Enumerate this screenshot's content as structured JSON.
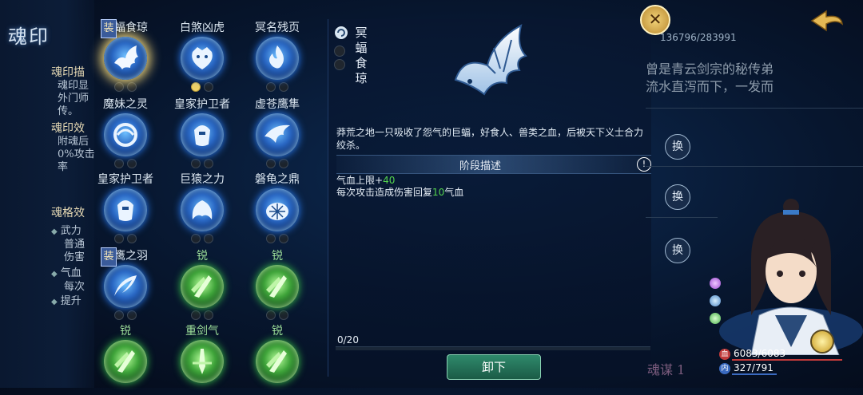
{
  "sidebar": {
    "title": "魂印",
    "section1_title": "魂印描",
    "section1_lines": [
      "魂印显",
      "外门师",
      "传。"
    ],
    "section2_title": "魂印效",
    "section2_lines": [
      "附魂后",
      "0%攻击",
      "率"
    ],
    "section3_title": "魂格效",
    "section3_items": [
      "武力",
      "普通",
      "伤害",
      "气血",
      "每次",
      "提升"
    ]
  },
  "grid": [
    {
      "label": "冥蝠食琼",
      "type": "blue",
      "icon": "bat-icon",
      "selected": true,
      "badge": "装",
      "slots": [
        "empty",
        "empty"
      ]
    },
    {
      "label": "白煞凶虎",
      "type": "blue",
      "icon": "tiger-icon",
      "selected": false,
      "badge": "",
      "slots": [
        "gold",
        "empty"
      ]
    },
    {
      "label": "冥名残页",
      "type": "blue",
      "icon": "flame-icon",
      "selected": false,
      "badge": "",
      "slots": [
        "empty",
        "empty"
      ]
    },
    {
      "label": "魔妹之灵",
      "type": "blue",
      "icon": "spirit-icon",
      "selected": false,
      "badge": "",
      "slots": [
        "empty",
        "empty"
      ]
    },
    {
      "label": "皇家护卫者",
      "type": "blue",
      "icon": "guardian-icon",
      "selected": false,
      "badge": "",
      "slots": [
        "empty",
        "empty"
      ]
    },
    {
      "label": "虚苍鹰隼",
      "type": "blue",
      "icon": "falcon-icon",
      "selected": false,
      "badge": "",
      "slots": [
        "empty",
        "empty"
      ]
    },
    {
      "label": "皇家护卫者",
      "type": "blue",
      "icon": "guardian-icon",
      "selected": false,
      "badge": "",
      "slots": [
        "empty",
        "empty"
      ]
    },
    {
      "label": "巨猿之力",
      "type": "blue",
      "icon": "ape-icon",
      "selected": false,
      "badge": "",
      "slots": [
        "empty",
        "empty"
      ]
    },
    {
      "label": "磐龟之鼎",
      "type": "blue",
      "icon": "turtle-icon",
      "selected": false,
      "badge": "",
      "slots": [
        "empty",
        "empty"
      ]
    },
    {
      "label": "狐鹰之羽",
      "type": "blue",
      "icon": "feather-icon",
      "selected": false,
      "badge": "装",
      "slots": [
        "empty",
        "empty"
      ]
    },
    {
      "label": "锐",
      "type": "green",
      "icon": "sharp-icon",
      "selected": false,
      "badge": "",
      "slots": [
        "empty",
        "empty"
      ]
    },
    {
      "label": "锐",
      "type": "green",
      "icon": "sharp-icon",
      "selected": false,
      "badge": "",
      "slots": [
        "empty",
        "empty"
      ]
    },
    {
      "label": "锐",
      "type": "green",
      "icon": "sharp-icon",
      "selected": false,
      "badge": "",
      "slots": []
    },
    {
      "label": "重剑气",
      "type": "green",
      "icon": "sword-qi-icon",
      "selected": false,
      "badge": "",
      "slots": []
    },
    {
      "label": "锐",
      "type": "green",
      "icon": "sharp-icon",
      "selected": false,
      "badge": "",
      "slots": []
    }
  ],
  "detail": {
    "name_chars": [
      "冥",
      "蝠",
      "食",
      "琼"
    ],
    "description": "莽荒之地一只吸收了怨气的巨蝠，好食人、兽类之血，后被天下义士合力绞杀。",
    "stage_label": "阶段描述",
    "info_symbol": "!",
    "stat1_prefix": "气血上限+",
    "stat1_value": "40",
    "stat2_prefix": "每次攻击造成伤害回复",
    "stat2_value": "10",
    "stat2_suffix": "气血",
    "progress_text": "0/20",
    "progress": 0,
    "unload_label": "卸下"
  },
  "right": {
    "close_symbol": "✕",
    "exp_text": "136796/283991",
    "story_line1": "曾是青云剑宗的秘传弟",
    "story_line2": "流水直泻而下，一发而",
    "swap_label": "换",
    "hp_icon": "血",
    "hp_text": "6083/6083",
    "mp_icon": "内",
    "mp_text": "327/791",
    "bottom_text": "魂谋 1"
  },
  "colors": {
    "accent_green": "#54d44e",
    "gold": "#f0d266",
    "button": "#1b5b46"
  }
}
